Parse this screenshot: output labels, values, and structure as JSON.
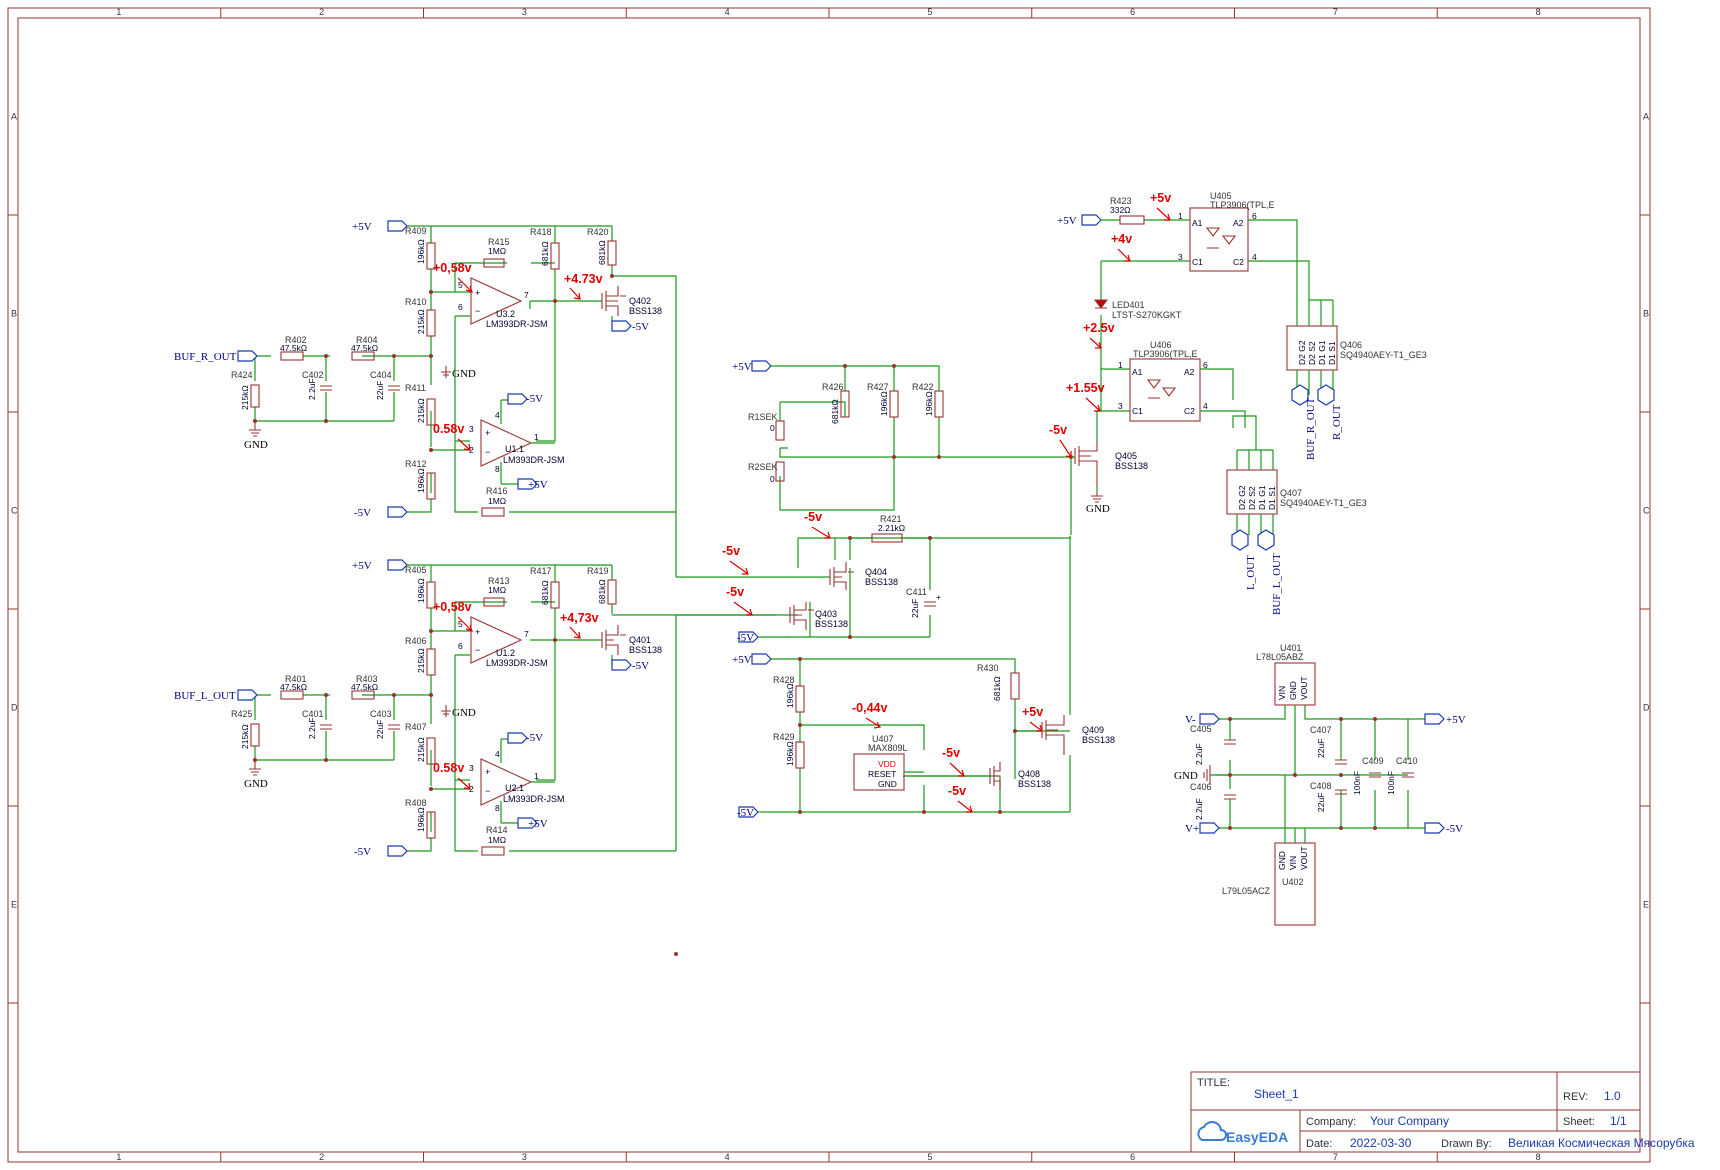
{
  "title_block": {
    "title_label": "TITLE:",
    "title_value": "Sheet_1",
    "rev_label": "REV:",
    "rev_value": "1.0",
    "company_label": "Company:",
    "company_value": "Your Company",
    "sheet_label": "Sheet:",
    "sheet_value": "1/1",
    "date_label": "Date:",
    "date_value": "2022-03-30",
    "drawn_label": "Drawn By:",
    "drawn_value": "Великая Космическая Мясорубка",
    "logo": "EasyEDA"
  },
  "grid": {
    "cols": [
      "1",
      "2",
      "3",
      "4",
      "5",
      "6",
      "7",
      "8"
    ],
    "rows": [
      "A",
      "B",
      "C",
      "D",
      "E"
    ]
  },
  "nets": {
    "buf_r_out": "BUF_R_OUT",
    "buf_l_out": "BUF_L_OUT",
    "p5v": "+5V",
    "m5v": "-5V",
    "gnd": "GND",
    "v_plus": "V+",
    "v_minus": "V-",
    "r_out": "R_OUT",
    "l_out": "L_OUT"
  },
  "components": {
    "r409": [
      "R409",
      "196kΩ"
    ],
    "r410": [
      "R410",
      "215kΩ"
    ],
    "r411": [
      "R411",
      "215kΩ"
    ],
    "r412": [
      "R412",
      "196kΩ"
    ],
    "r415": [
      "R415",
      "1MΩ"
    ],
    "r416": [
      "R416",
      "1MΩ"
    ],
    "r418": [
      "R418",
      "681kΩ"
    ],
    "r420": [
      "R420",
      "681kΩ"
    ],
    "r402": [
      "R402",
      "47.5kΩ"
    ],
    "r404": [
      "R404",
      "47.5kΩ"
    ],
    "r424": [
      "R424",
      "215kΩ"
    ],
    "c402": [
      "C402",
      "2.2uF"
    ],
    "c404": [
      "C404",
      "22uF"
    ],
    "u3_2": [
      "U3.2",
      "LM393DR-JSM"
    ],
    "u1_1": [
      "U1.1",
      "LM393DR-JSM"
    ],
    "q402": [
      "Q402",
      "BSS138"
    ],
    "r405": [
      "R405",
      "196kΩ"
    ],
    "r406": [
      "R406",
      "215kΩ"
    ],
    "r407": [
      "R407",
      "215kΩ"
    ],
    "r408": [
      "R408",
      "196kΩ"
    ],
    "r413": [
      "R413",
      "1MΩ"
    ],
    "r414": [
      "R414",
      "1MΩ"
    ],
    "r417": [
      "R417",
      "681kΩ"
    ],
    "r419": [
      "R419",
      "681kΩ"
    ],
    "r401": [
      "R401",
      "47.5kΩ"
    ],
    "r403": [
      "R403",
      "47.5kΩ"
    ],
    "r425": [
      "R425",
      "215kΩ"
    ],
    "c401": [
      "C401",
      "2.2uF"
    ],
    "c403": [
      "C403",
      "22uF"
    ],
    "u1_2": [
      "U1.2",
      "LM393DR-JSM"
    ],
    "u2_1": [
      "U2.1",
      "LM393DR-JSM"
    ],
    "q401": [
      "Q401",
      "BSS138"
    ],
    "r426": [
      "R426",
      "681kΩ"
    ],
    "r427": [
      "R427",
      "196kΩ"
    ],
    "r422": [
      "R422",
      "196kΩ"
    ],
    "r1sek": [
      "R1SEK",
      "0"
    ],
    "r2sek": [
      "R2SEK",
      "0"
    ],
    "r421": [
      "R421",
      "2.21kΩ"
    ],
    "c411": [
      "C411",
      "22uF"
    ],
    "q404": [
      "Q404",
      "BSS138"
    ],
    "q403": [
      "Q403",
      "BSS138"
    ],
    "r428": [
      "R428",
      "196kΩ"
    ],
    "r429": [
      "R429",
      "196kΩ"
    ],
    "r430": [
      "R430",
      "681kΩ"
    ],
    "u407": [
      "U407",
      "MAX809L"
    ],
    "u407_pins": [
      "VDD",
      "RESET",
      "GND"
    ],
    "q408": [
      "Q408",
      "BSS138"
    ],
    "q409": [
      "Q409",
      "BSS138"
    ],
    "q405": [
      "Q405",
      "BSS138"
    ],
    "r423": [
      "R423",
      "332Ω"
    ],
    "u405": [
      "U405",
      "TLP3906(TPL,E"
    ],
    "u406": [
      "U406",
      "TLP3906(TPL,E"
    ],
    "led401": [
      "LED401",
      "LTST-S270KGKT"
    ],
    "q406": [
      "Q406",
      "SQ4940AEY-T1_GE3"
    ],
    "q407": [
      "Q407",
      "SQ4940AEY-T1_GE3"
    ],
    "u401": [
      "U401",
      "L78L05ABZ"
    ],
    "u402": [
      "U402",
      "L79L05ACZ"
    ],
    "c405": [
      "C405",
      "2.2uF"
    ],
    "c406": [
      "C406",
      "2.2uF"
    ],
    "c407": [
      "C407",
      "22uF"
    ],
    "c408": [
      "C408",
      "22uF"
    ],
    "c409": [
      "C409",
      "100nF"
    ],
    "c410": [
      "C410",
      "100nF"
    ]
  },
  "voltages": {
    "v058a": "+0,58v",
    "v058b": "0.58v",
    "v473a": "+4.73v",
    "v058c": "+0,58v",
    "v058d": "0.58v",
    "v473b": "+4,73v",
    "vm5a": "-5v",
    "vm5b": "-5v",
    "vm5c": "-5v",
    "vm5d": "-5v",
    "vm044": "-0,44v",
    "vm5e": "-5v",
    "vm5f": "-5v",
    "vp5a": "+5v",
    "vp5b": "+5v",
    "vp4": "+4v",
    "vp25": "+2.5v",
    "vp155": "+1.55v"
  }
}
